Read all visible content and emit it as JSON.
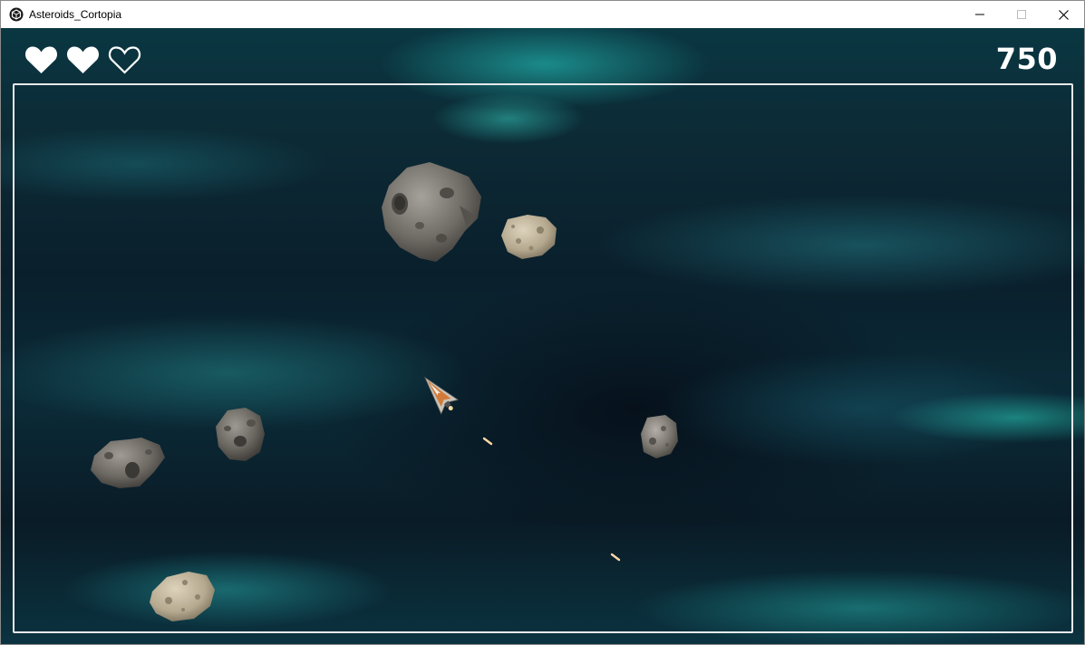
{
  "window": {
    "title": "Asteroids_Cortopia",
    "app_icon": "unity-cube-icon",
    "controls": [
      "minimize-icon",
      "maximize-icon",
      "close-icon"
    ]
  },
  "hud": {
    "lives": {
      "filled": 2,
      "total": 3
    },
    "score": "750"
  },
  "colors": {
    "hud": "#ffffff",
    "border": "#e6e9ec",
    "space_dark": "#0a1f2c",
    "nebula": "#2ad2c8"
  },
  "sprites": {
    "asteroids": [
      "large-gray-asteroid",
      "small-tan-asteroid",
      "small-gray-asteroid",
      "small-gray-asteroid",
      "medium-gray-asteroid",
      "small-tan-asteroid"
    ],
    "ship": "player-spaceship",
    "bullets": [
      "laser-bullet",
      "laser-bullet"
    ]
  }
}
